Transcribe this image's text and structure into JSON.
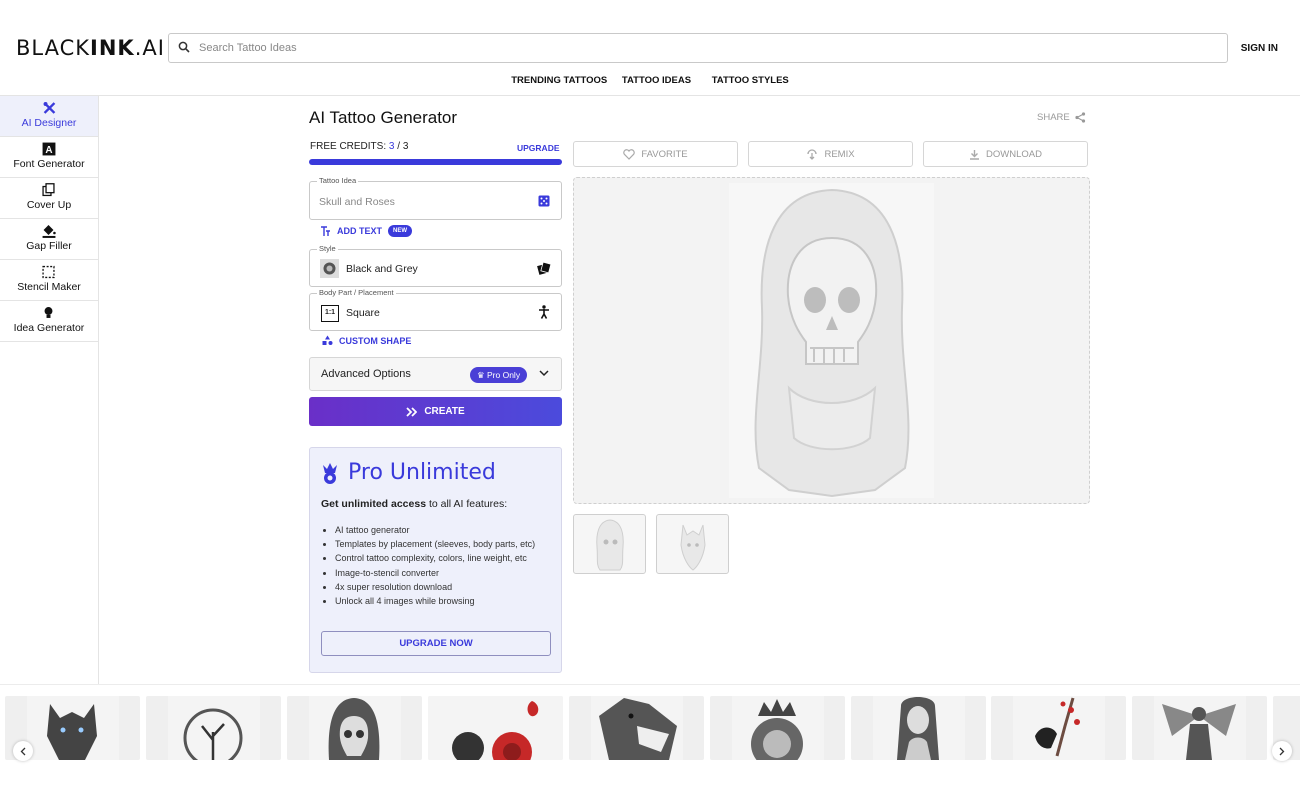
{
  "header": {
    "logo_light": "BLACK",
    "logo_bold": "INK",
    "logo_suffix": ".AI",
    "search_placeholder": "Search Tattoo Ideas",
    "sign_in": "SIGN IN"
  },
  "nav": [
    "TRENDING TATTOOS",
    "TATTOO IDEAS",
    "TATTOO STYLES"
  ],
  "sidebar": [
    {
      "label": "AI Designer",
      "icon": "pencil-ruler-icon",
      "active": true
    },
    {
      "label": "Font Generator",
      "icon": "font-icon"
    },
    {
      "label": "Cover Up",
      "icon": "cover-up-icon"
    },
    {
      "label": "Gap Filler",
      "icon": "paint-bucket-icon"
    },
    {
      "label": "Stencil Maker",
      "icon": "stencil-icon"
    },
    {
      "label": "Idea Generator",
      "icon": "lightbulb-icon"
    }
  ],
  "main": {
    "title": "AI Tattoo Generator",
    "share": "SHARE",
    "credits_label": "FREE CREDITS:",
    "credits_used": "3",
    "credits_total": "3",
    "credits_fraction": 1.0,
    "upgrade": "UPGRADE",
    "tattoo_idea": {
      "legend": "Tattoo Idea",
      "placeholder": "Skull and Roses"
    },
    "add_text": "ADD TEXT",
    "new_badge": "NEW",
    "style": {
      "legend": "Style",
      "value": "Black and Grey"
    },
    "placement": {
      "legend": "Body Part / Placement",
      "value": "Square",
      "icon_text": "1:1"
    },
    "custom_shape": "CUSTOM SHAPE",
    "advanced": "Advanced Options",
    "pro_only": "Pro Only",
    "create": "CREATE"
  },
  "promo": {
    "title": "Pro Unlimited",
    "desc_bold": "Get unlimited access",
    "desc_rest": " to all AI features:",
    "features": [
      "AI tattoo generator",
      "Templates by placement (sleeves, body parts, etc)",
      "Control tattoo complexity, colors, line weight, etc",
      "Image-to-stencil converter",
      "4x super resolution download",
      "Unlock all 4 images while browsing"
    ],
    "button": "UPGRADE NOW"
  },
  "actions": {
    "favorite": "FAVORITE",
    "remix": "REMIX",
    "download": "DOWNLOAD"
  },
  "colors": {
    "accent": "#3a3adb",
    "purple": "#6a2fc8",
    "promo_bg": "#eef0fb"
  }
}
